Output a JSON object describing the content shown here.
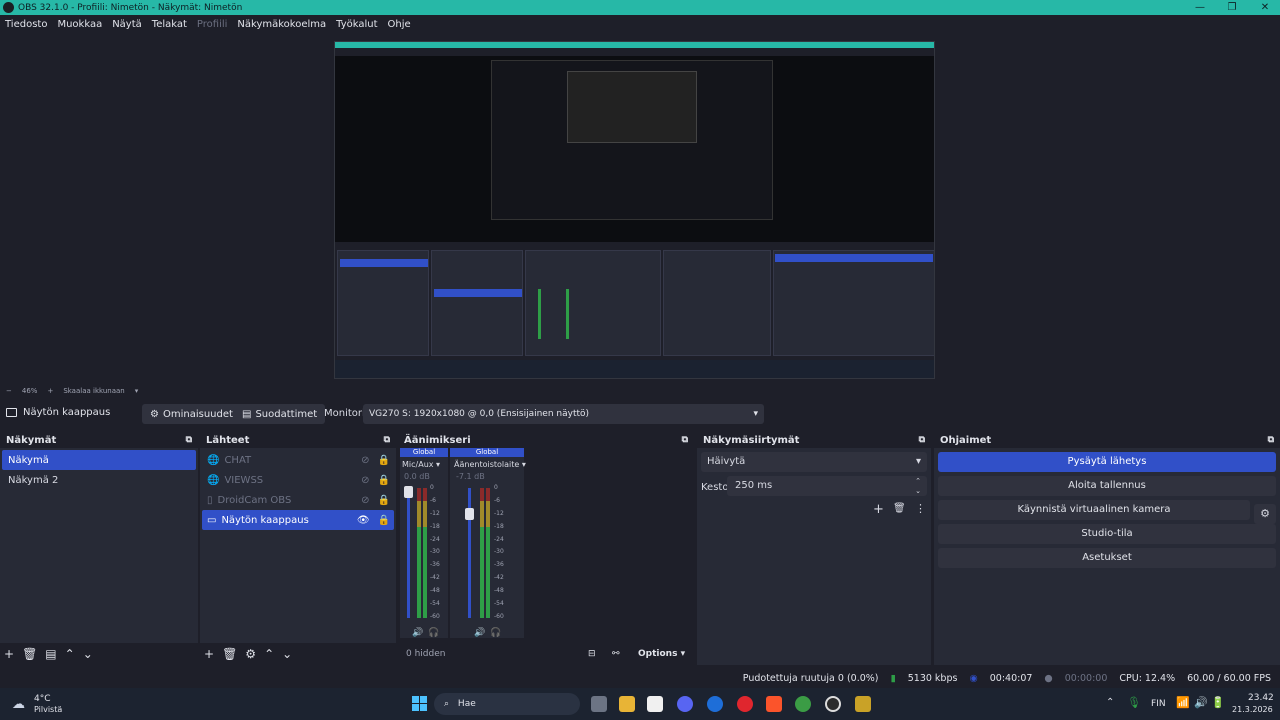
{
  "window": {
    "title": "OBS 32.1.0 - Profiili: Nimetön - Näkymät: Nimetön",
    "minimize": "—",
    "maximize": "❐",
    "close": "✕"
  },
  "menu": [
    "Tiedosto",
    "Muokkaa",
    "Näytä",
    "Telakat",
    "Profiili",
    "Näkymäkokoelma",
    "Työkalut",
    "Ohje"
  ],
  "zoom": {
    "value": "46%",
    "scale_label": "Skaalaa ikkunaan"
  },
  "context_bar": {
    "source_name": "Näytön kaappaus",
    "properties": "Ominaisuudet",
    "filters": "Suodattimet",
    "monitor_label": "Monitori",
    "monitor_value": "VG270 S: 1920x1080 @ 0,0 (Ensisijainen näyttö)"
  },
  "scenes": {
    "title": "Näkymät",
    "items": [
      "Näkymä",
      "Näkymä 2"
    ]
  },
  "sources": {
    "title": "Lähteet",
    "items": [
      "CHAT",
      "VIEWSS",
      "DroidCam OBS",
      "Näytön kaappaus"
    ]
  },
  "mixer": {
    "title": "Äänimikseri",
    "channels": [
      {
        "badge": "Global",
        "name": "Mic/Aux",
        "db": "0.0 dB",
        "fader": 0.97
      },
      {
        "badge": "Global",
        "name": "Äänentoistolaite",
        "db": "-7.1 dB",
        "fader": 0.8
      }
    ],
    "scale": [
      "0",
      "-6",
      "-12",
      "-18",
      "-24",
      "-30",
      "-36",
      "-42",
      "-48",
      "-54",
      "-60"
    ],
    "hidden": "0 hidden",
    "options": "Options"
  },
  "transitions": {
    "title": "Näkymäsiirtymät",
    "selected": "Häivytä",
    "duration_label": "Kesto",
    "duration_value": "250 ms"
  },
  "controls": {
    "title": "Ohjaimet",
    "buttons": [
      "Pysäytä lähetys",
      "Aloita tallennus",
      "Käynnistä virtuaalinen kamera",
      "Studio-tila",
      "Asetukset"
    ]
  },
  "status": {
    "dropped": "Pudotettuja ruutuja 0 (0.0%)",
    "bitrate": "5130 kbps",
    "stream_time": "00:40:07",
    "rec_time": "00:00:00",
    "cpu": "CPU: 12.4%",
    "fps": "60.00 / 60.00 FPS"
  },
  "taskbar": {
    "temperature": "4°C",
    "weather": "Pilvistä",
    "search": "Hae",
    "language": "FIN",
    "time": "23.42",
    "date": "21.3.2026"
  },
  "colors": {
    "accent": "#3150c8",
    "titlebar": "#27b8a7",
    "background": "#1e1f29",
    "dock": "#272a36"
  }
}
